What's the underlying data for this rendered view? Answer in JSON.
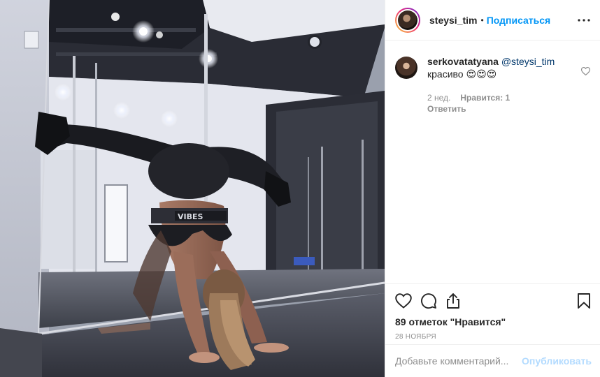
{
  "header": {
    "username": "steysi_tim",
    "separator": "•",
    "follow_label": "Подписаться",
    "more_icon": "more-horizontal-icon"
  },
  "comments": [
    {
      "username": "serkovatatyana",
      "mention": "@steysi_tim",
      "text": "красиво 😍😍😍",
      "time": "2 нед.",
      "likes": "Нравится: 1",
      "reply_label": "Ответить"
    }
  ],
  "actions": {
    "like_icon": "heart-outline-icon",
    "comment_icon": "comment-bubble-icon",
    "share_icon": "share-icon",
    "save_icon": "bookmark-icon"
  },
  "likes_text": "89 отметок \"Нравится\"",
  "date": "28 НОЯБРЯ",
  "add_comment": {
    "placeholder": "Добавьте комментарий...",
    "publish_label": "Опубликовать"
  },
  "colors": {
    "accent": "#0095f6",
    "publish_disabled": "#b3dbff",
    "mention": "#00376b",
    "secondary_text": "#8e8e8e"
  }
}
